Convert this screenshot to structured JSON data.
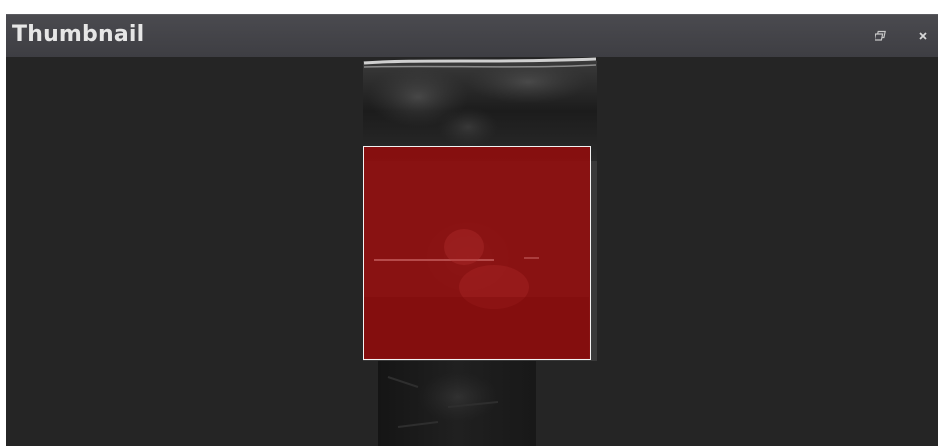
{
  "window": {
    "title": "Thumbnail"
  },
  "titlebar_buttons": [
    {
      "name": "restore",
      "icon": "restore-icon"
    },
    {
      "name": "close",
      "icon": "close-icon"
    }
  ],
  "colors": {
    "panel_background": "#262626",
    "titlebar": "#44444a",
    "title_text": "#e6e6e6",
    "viewport_fill": "#960c0c",
    "viewport_border": "#f2f2f2"
  }
}
